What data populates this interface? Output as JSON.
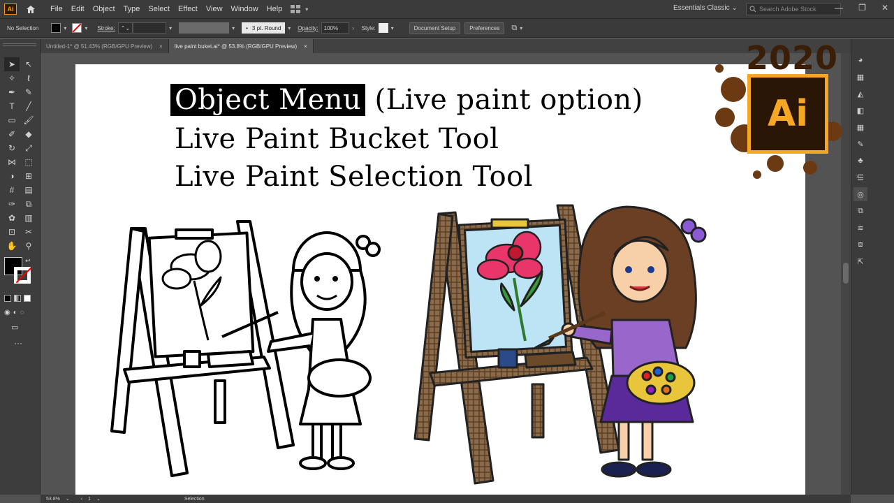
{
  "app": {
    "logo_text": "Ai",
    "menu": [
      "File",
      "Edit",
      "Object",
      "Type",
      "Select",
      "Effect",
      "View",
      "Window",
      "Help"
    ],
    "workspace": "Essentials Classic",
    "search_placeholder": "Search Adobe Stock"
  },
  "control_bar": {
    "selection_label": "No Selection",
    "stroke_label": "Stroke:",
    "brush_label": "3 pt. Round",
    "opacity_label": "Opacity:",
    "opacity_value": "100%",
    "style_label": "Style:",
    "document_setup": "Document Setup",
    "preferences": "Preferences"
  },
  "tabs": [
    {
      "label": "Untitled-1* @ 51.43% (RGB/GPU Preview)",
      "close": "×"
    },
    {
      "label": "live paint buket.ai* @ 53.8% (RGB/GPU Preview)",
      "close": "×"
    }
  ],
  "artboard": {
    "line1_highlight": "Object Menu",
    "line1_rest": " (Live paint option)",
    "line2": "Live Paint Bucket Tool",
    "line3": "Live Paint Selection Tool"
  },
  "badge": {
    "year": "2020",
    "logo": "Ai"
  },
  "status_bar": {
    "zoom": "53.8%",
    "artboard_num": "1",
    "tool": "Selection"
  },
  "colors": {
    "accent_orange": "#f5a623",
    "easel_wood": "#7a5a38",
    "canvas_blue": "#bde4f4",
    "flower_pink": "#e8366b",
    "dress_purple": "#9966cc"
  }
}
